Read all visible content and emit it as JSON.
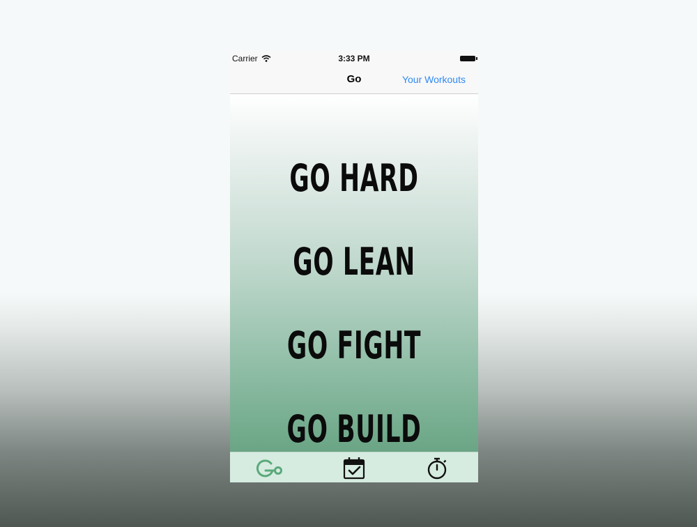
{
  "status_bar": {
    "carrier": "Carrier",
    "time": "3:33 PM"
  },
  "nav": {
    "title": "Go",
    "right_button": "Your Workouts"
  },
  "items": [
    {
      "label": "GO HARD"
    },
    {
      "label": "GO LEAN"
    },
    {
      "label": "GO FIGHT"
    },
    {
      "label": "GO BUILD"
    }
  ],
  "tabs": [
    {
      "icon": "go-logo-icon",
      "active": true
    },
    {
      "icon": "calendar-check-icon",
      "active": false
    },
    {
      "icon": "stopwatch-icon",
      "active": false
    }
  ],
  "colors": {
    "accent": "#2f89f5",
    "tab_active": "#5aa97a",
    "tab_bar": "#d6ece0"
  }
}
